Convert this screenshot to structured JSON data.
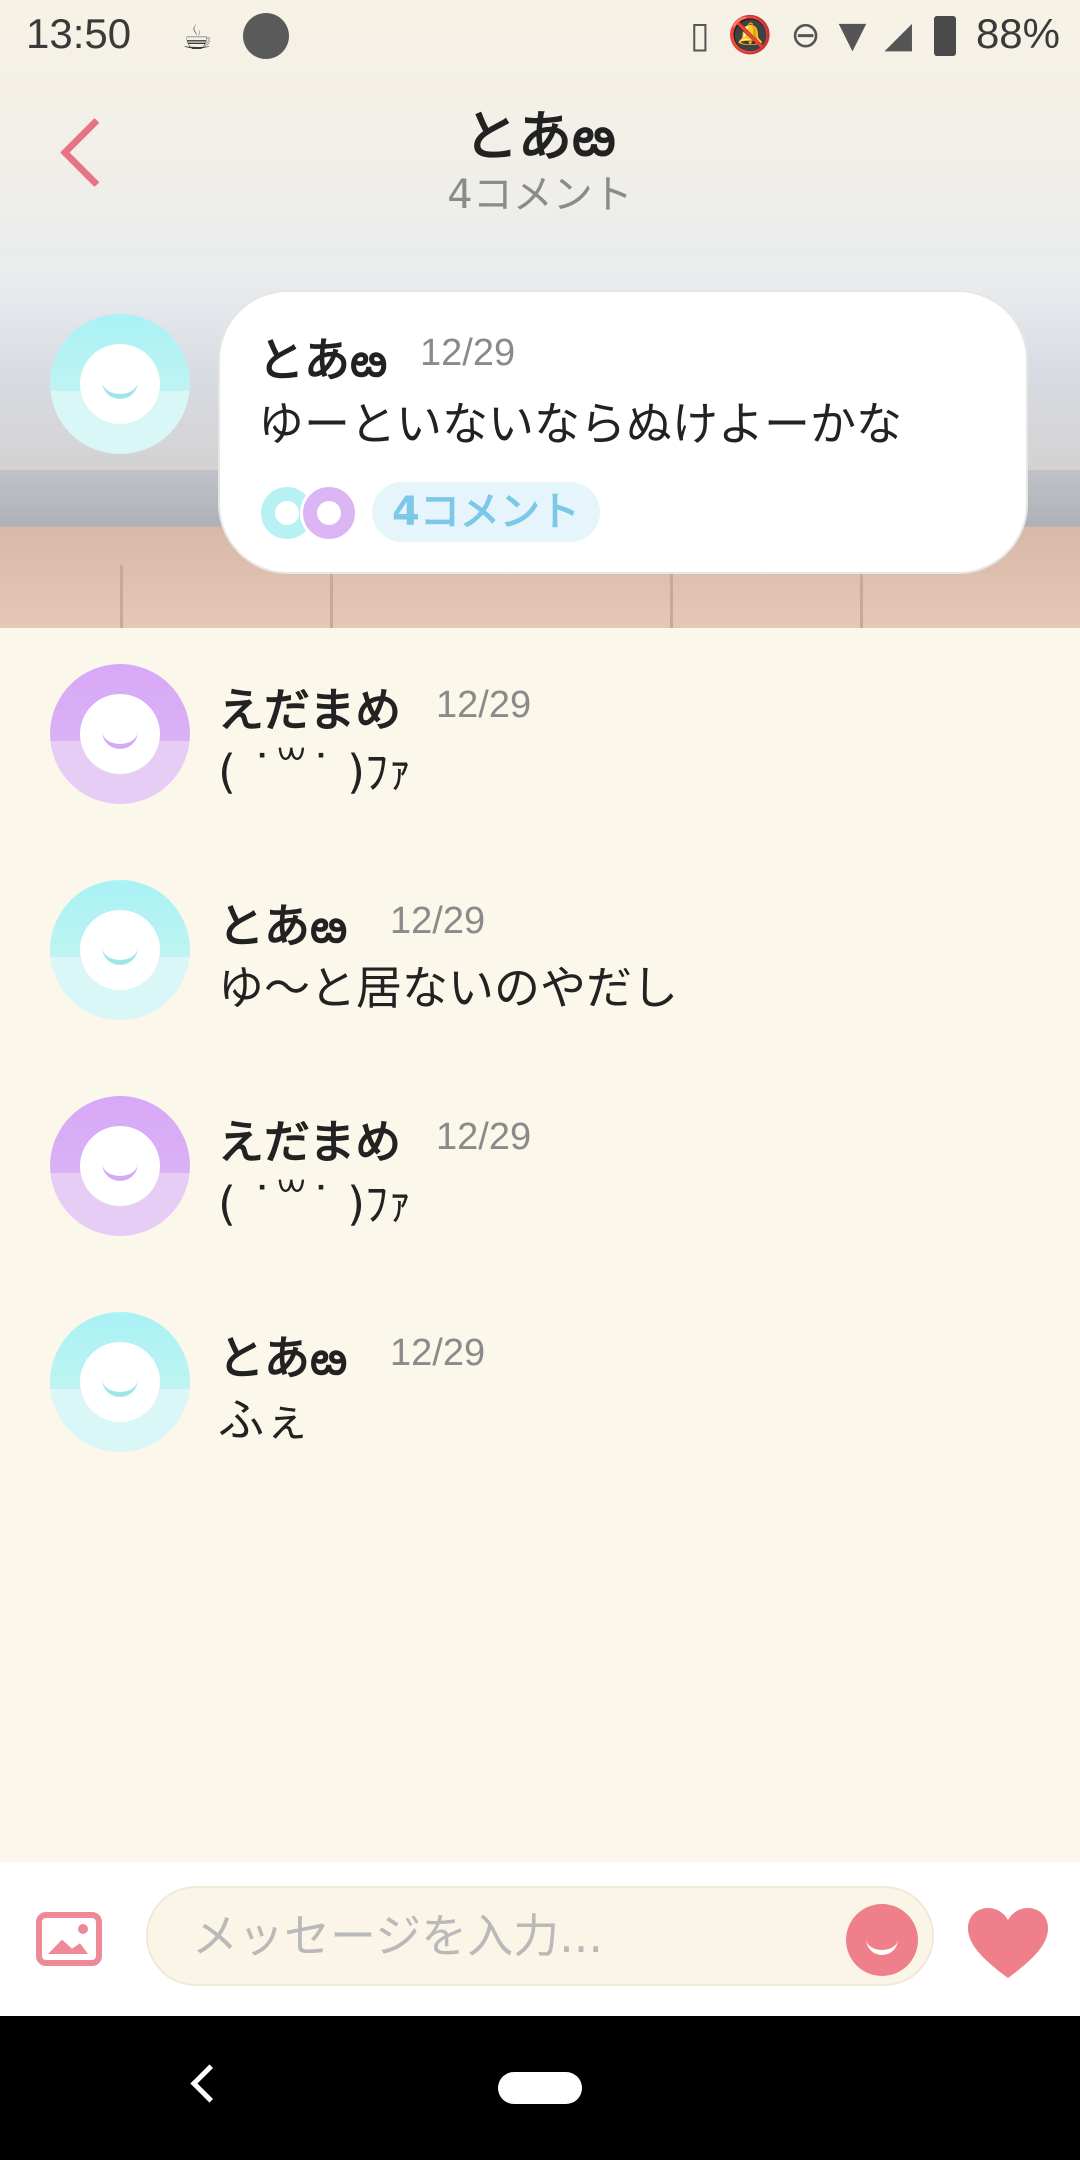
{
  "status_bar": {
    "time": "13:50",
    "battery": "88%",
    "icons": [
      "coffee-icon",
      "circle-icon",
      "nfc-icon",
      "notifications-off-icon",
      "do-not-disturb-icon",
      "wifi-icon",
      "signal-icon",
      "battery-icon"
    ]
  },
  "header": {
    "title": "とあఴ",
    "subtitle": "4コメント"
  },
  "post": {
    "author": "とあఴ",
    "date": "12/29",
    "message": "ゆーといないならぬけよーかな",
    "comments_pill": "4コメント"
  },
  "comments": [
    {
      "author": "えだまめ",
      "date": "12/29",
      "message": "( ˙꒳˙ )ﾌｧ",
      "avatar": "purple"
    },
    {
      "author": "とあఴ",
      "date": "12/29",
      "message": "ゆ〜と居ないのやだし",
      "avatar": "cyan"
    },
    {
      "author": "えだまめ",
      "date": "12/29",
      "message": "( ˙꒳˙ )ﾌｧ",
      "avatar": "purple"
    },
    {
      "author": "とあఴ",
      "date": "12/29",
      "message": "ふぇ",
      "avatar": "cyan"
    }
  ],
  "input": {
    "placeholder": "メッセージを入力..."
  },
  "colors": {
    "accent": "#ef7f8b",
    "background": "#fbf7ea",
    "pill_text": "#7dc8e8"
  }
}
